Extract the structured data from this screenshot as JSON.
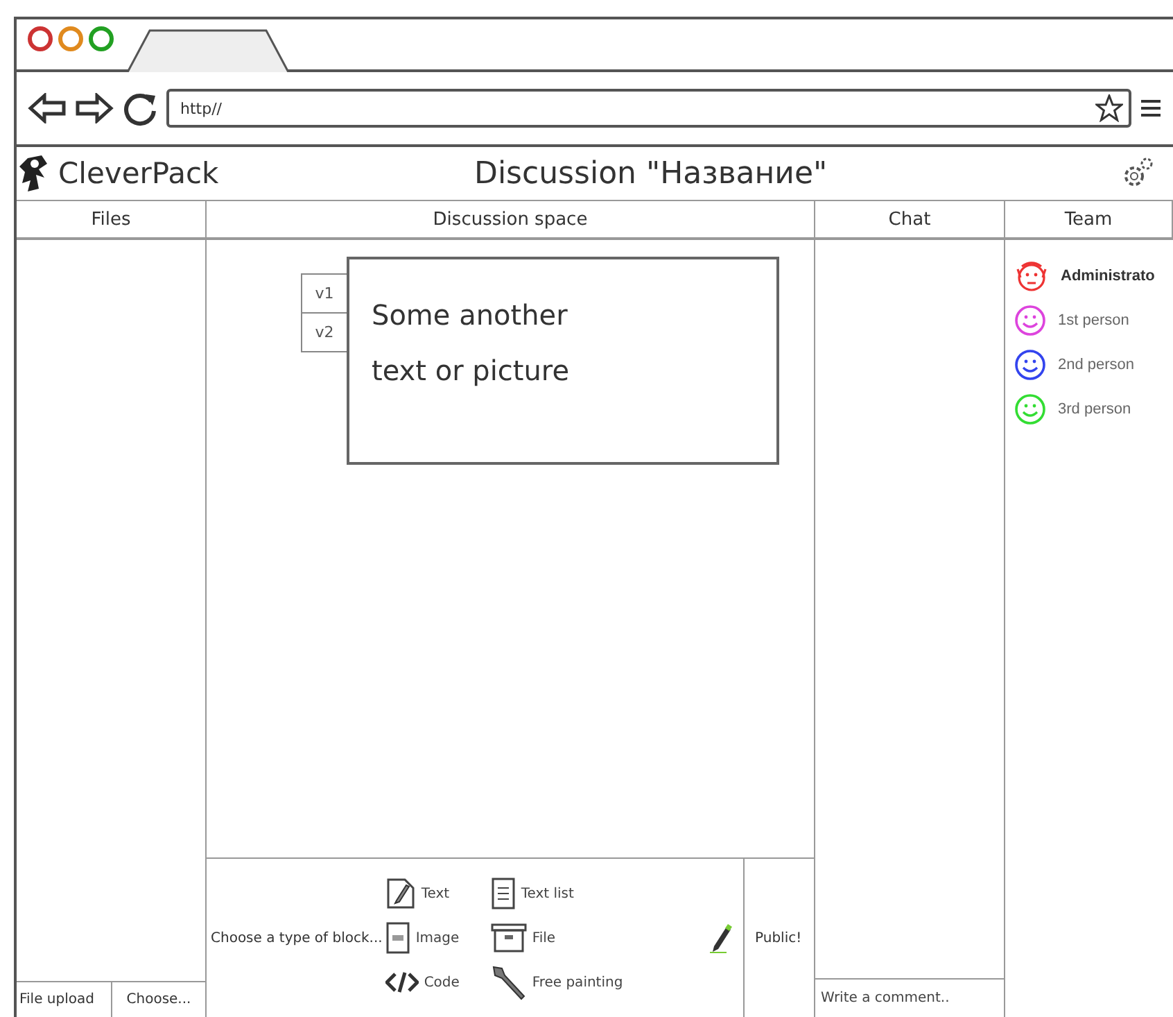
{
  "browser": {
    "lights": [
      {
        "color": "#cc3333"
      },
      {
        "color": "#e08a1e"
      },
      {
        "color": "#22a022"
      }
    ],
    "url": "http//"
  },
  "header": {
    "logo": "CleverPack",
    "title": "Discussion \"Название\""
  },
  "columns": {
    "files": "Files",
    "discussion": "Discussion space",
    "chat": "Chat",
    "team": "Team"
  },
  "files": {
    "upload_label": "File upload",
    "choose_button": "Choose..."
  },
  "block": {
    "versions": [
      "v1",
      "v2"
    ],
    "lines": [
      "Some another",
      "text or picture"
    ]
  },
  "toolbar": {
    "prompt": "Choose a type of block...",
    "types": [
      {
        "kind": "text",
        "label": "Text"
      },
      {
        "kind": "list",
        "label": "Text list"
      },
      {
        "kind": "image",
        "label": "Image"
      },
      {
        "kind": "file",
        "label": "File"
      },
      {
        "kind": "code",
        "label": "Code"
      },
      {
        "kind": "painting",
        "label": "Free painting"
      }
    ],
    "publish_button": "Public!"
  },
  "chat": {
    "placeholder": "Write a comment.."
  },
  "team": [
    {
      "kind": "admin",
      "name": "Administrato",
      "color": "#ee3333"
    },
    {
      "kind": "person",
      "name": "1st person",
      "color": "#dd44dd"
    },
    {
      "kind": "person",
      "name": "2nd person",
      "color": "#3344ee"
    },
    {
      "kind": "person",
      "name": "3rd person",
      "color": "#33dd33"
    }
  ]
}
